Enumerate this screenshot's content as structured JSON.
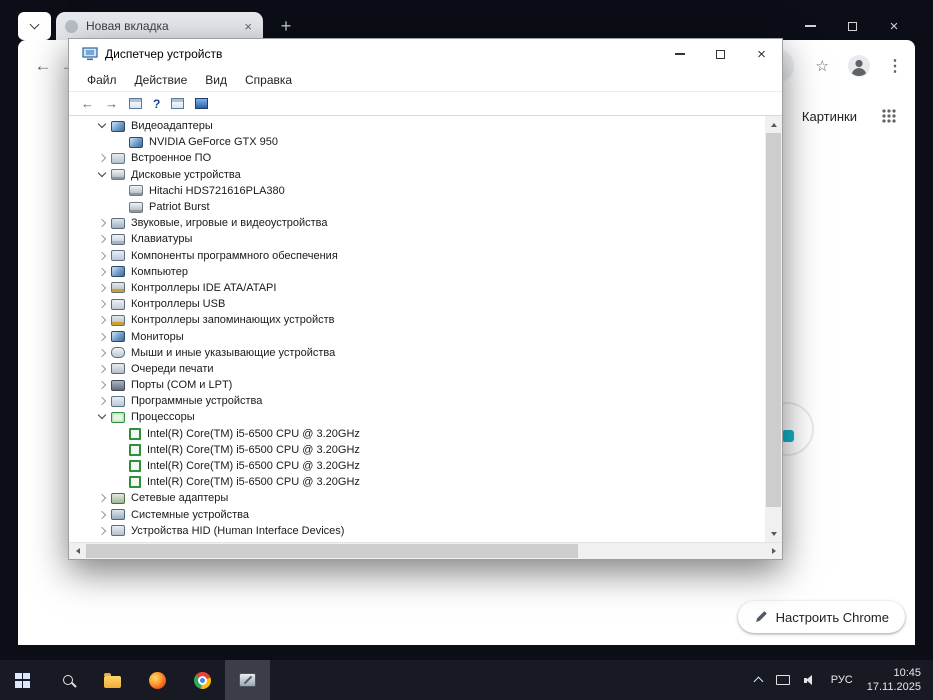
{
  "chrome": {
    "tab_title": "Новая вкладка",
    "images_link": "Картинки",
    "customize_button": "Настроить Chrome"
  },
  "device_manager": {
    "title": "Диспетчер устройств",
    "menus": [
      "Файл",
      "Действие",
      "Вид",
      "Справка"
    ],
    "tree": [
      {
        "label": "Видеоадаптеры",
        "icon": "display-adapter-icon",
        "level": 0,
        "state": "expanded"
      },
      {
        "label": "NVIDIA GeForce GTX 950",
        "icon": "display-device-icon",
        "level": 1,
        "state": "leaf"
      },
      {
        "label": "Встроенное ПО",
        "icon": "firmware-icon",
        "level": 0,
        "state": "collapsed"
      },
      {
        "label": "Дисковые устройства",
        "icon": "disk-icon",
        "level": 0,
        "state": "expanded"
      },
      {
        "label": "Hitachi HDS721616PLA380",
        "icon": "disk-device-icon",
        "level": 1,
        "state": "leaf"
      },
      {
        "label": "Patriot Burst",
        "icon": "disk-device-icon",
        "level": 1,
        "state": "leaf"
      },
      {
        "label": "Звуковые, игровые и видеоустройства",
        "icon": "sound-icon",
        "level": 0,
        "state": "collapsed"
      },
      {
        "label": "Клавиатуры",
        "icon": "keyboard-icon",
        "level": 0,
        "state": "collapsed"
      },
      {
        "label": "Компоненты программного обеспечения",
        "icon": "software-component-icon",
        "level": 0,
        "state": "collapsed"
      },
      {
        "label": "Компьютер",
        "icon": "computer-icon",
        "level": 0,
        "state": "collapsed"
      },
      {
        "label": "Контроллеры IDE ATA/ATAPI",
        "icon": "ide-controller-icon",
        "level": 0,
        "state": "collapsed"
      },
      {
        "label": "Контроллеры USB",
        "icon": "usb-controller-icon",
        "level": 0,
        "state": "collapsed"
      },
      {
        "label": "Контроллеры запоминающих устройств",
        "icon": "storage-controller-icon",
        "level": 0,
        "state": "collapsed"
      },
      {
        "label": "Мониторы",
        "icon": "monitor-icon",
        "level": 0,
        "state": "collapsed"
      },
      {
        "label": "Мыши и иные указывающие устройства",
        "icon": "mouse-icon",
        "level": 0,
        "state": "collapsed"
      },
      {
        "label": "Очереди печати",
        "icon": "print-queue-icon",
        "level": 0,
        "state": "collapsed"
      },
      {
        "label": "Порты (COM и LPT)",
        "icon": "ports-icon",
        "level": 0,
        "state": "collapsed"
      },
      {
        "label": "Программные устройства",
        "icon": "software-device-icon",
        "level": 0,
        "state": "collapsed"
      },
      {
        "label": "Процессоры",
        "icon": "cpu-icon",
        "level": 0,
        "state": "expanded"
      },
      {
        "label": "Intel(R) Core(TM) i5-6500 CPU @ 3.20GHz",
        "icon": "cpu-device-icon",
        "level": 1,
        "state": "leaf"
      },
      {
        "label": "Intel(R) Core(TM) i5-6500 CPU @ 3.20GHz",
        "icon": "cpu-device-icon",
        "level": 1,
        "state": "leaf"
      },
      {
        "label": "Intel(R) Core(TM) i5-6500 CPU @ 3.20GHz",
        "icon": "cpu-device-icon",
        "level": 1,
        "state": "leaf"
      },
      {
        "label": "Intel(R) Core(TM) i5-6500 CPU @ 3.20GHz",
        "icon": "cpu-device-icon",
        "level": 1,
        "state": "leaf"
      },
      {
        "label": "Сетевые адаптеры",
        "icon": "network-adapter-icon",
        "level": 0,
        "state": "collapsed"
      },
      {
        "label": "Системные устройства",
        "icon": "system-device-icon",
        "level": 0,
        "state": "collapsed"
      },
      {
        "label": "Устройства HID (Human Interface Devices)",
        "icon": "hid-icon",
        "level": 0,
        "state": "collapsed"
      }
    ]
  },
  "taskbar": {
    "language": "РУС",
    "time": "10:45",
    "date": "17.11.2025"
  },
  "colors": {
    "desktop_bg": "#0c0e17",
    "taskbar_bg": "#171923",
    "accent_blue": "#4285f4",
    "cpu_green": "#2f8f3a"
  }
}
